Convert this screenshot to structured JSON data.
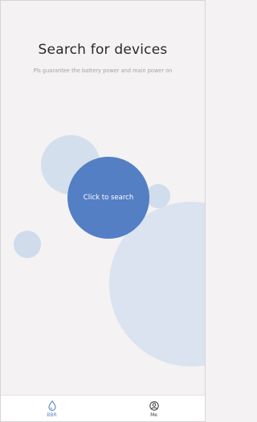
{
  "header": {
    "title": "Search for devices",
    "subtitle": "Pls guarantee the battery power and main power on"
  },
  "search_button": {
    "label": "Click to search"
  },
  "tabbar": {
    "tabs": [
      {
        "label": "BBR",
        "icon": "drop-icon",
        "active": true
      },
      {
        "label": "Me",
        "icon": "user-icon",
        "active": false
      }
    ]
  },
  "colors": {
    "accent": "#547fc4",
    "bubble": "#d4dfee",
    "background": "#f4f2f2"
  }
}
